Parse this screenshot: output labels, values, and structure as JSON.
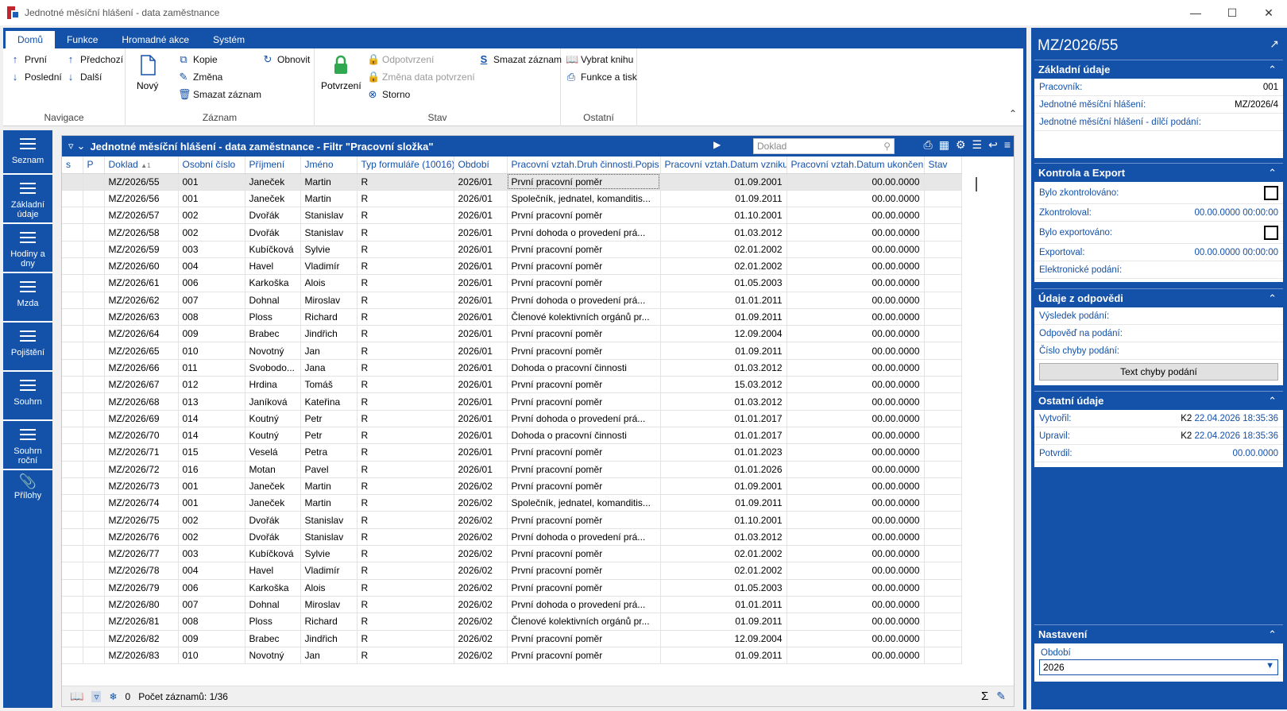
{
  "window": {
    "title": "Jednotné měsíční hlášení - data zaměstnance"
  },
  "ribbon": {
    "tabs": [
      "Domů",
      "Funkce",
      "Hromadné akce",
      "Systém"
    ],
    "groups": {
      "navigace": {
        "label": "Navigace",
        "prvni": "První",
        "predchozi": "Předchozí",
        "posledni": "Poslední",
        "dalsi": "Další"
      },
      "zaznam": {
        "label": "Záznam",
        "novy": "Nový",
        "kopie": "Kopie",
        "zmena": "Změna",
        "smazat": "Smazat záznam",
        "obnovit": "Obnovit"
      },
      "stav": {
        "label": "Stav",
        "potvrzeni": "Potvrzení",
        "odpotvrzeni": "Odpotvrzení",
        "zmena_data": "Změna data potvrzení",
        "storno": "Storno",
        "smazat": "Smazat záznam"
      },
      "ostatni": {
        "label": "Ostatní",
        "vybrat_knihu": "Vybrat knihu",
        "funkce_tisk": "Funkce a tisk"
      }
    }
  },
  "leftnav": [
    "Seznam",
    "Základní údaje",
    "Hodiny a dny",
    "Mzda",
    "Pojištění",
    "Souhrn",
    "Souhrn roční",
    "Přílohy"
  ],
  "grid": {
    "title": "Jednotné měsíční hlášení - data zaměstnance - Filtr \"Pracovní složka\"",
    "search_placeholder": "Doklad",
    "columns": [
      "s",
      "P",
      "Doklad",
      "Osobní číslo",
      "Příjmení",
      "Jméno",
      "Typ formuláře (10016)",
      "Období",
      "Pracovní vztah.Druh činnosti.Popis",
      "Pracovní vztah.Datum vzniku",
      "Pracovní vztah.Datum ukončení",
      "Stav"
    ],
    "sort_indicator": "▲1",
    "rows": [
      [
        "",
        "",
        "MZ/2026/55",
        "001",
        "Janeček",
        "Martin",
        "R",
        "2026/01",
        "První pracovní poměr",
        "01.09.2001",
        "00.00.0000",
        ""
      ],
      [
        "",
        "",
        "MZ/2026/56",
        "001",
        "Janeček",
        "Martin",
        "R",
        "2026/01",
        "Společník, jednatel, komanditis...",
        "01.09.2011",
        "00.00.0000",
        ""
      ],
      [
        "",
        "",
        "MZ/2026/57",
        "002",
        "Dvořák",
        "Stanislav",
        "R",
        "2026/01",
        "První pracovní poměr",
        "01.10.2001",
        "00.00.0000",
        ""
      ],
      [
        "",
        "",
        "MZ/2026/58",
        "002",
        "Dvořák",
        "Stanislav",
        "R",
        "2026/01",
        "První dohoda o provedení prá...",
        "01.03.2012",
        "00.00.0000",
        ""
      ],
      [
        "",
        "",
        "MZ/2026/59",
        "003",
        "Kubíčková",
        "Sylvie",
        "R",
        "2026/01",
        "První pracovní poměr",
        "02.01.2002",
        "00.00.0000",
        ""
      ],
      [
        "",
        "",
        "MZ/2026/60",
        "004",
        "Havel",
        "Vladimír",
        "R",
        "2026/01",
        "První pracovní poměr",
        "02.01.2002",
        "00.00.0000",
        ""
      ],
      [
        "",
        "",
        "MZ/2026/61",
        "006",
        "Karkoška",
        "Alois",
        "R",
        "2026/01",
        "První pracovní poměr",
        "01.05.2003",
        "00.00.0000",
        ""
      ],
      [
        "",
        "",
        "MZ/2026/62",
        "007",
        "Dohnal",
        "Miroslav",
        "R",
        "2026/01",
        "První dohoda o provedení prá...",
        "01.01.2011",
        "00.00.0000",
        ""
      ],
      [
        "",
        "",
        "MZ/2026/63",
        "008",
        "Ploss",
        "Richard",
        "R",
        "2026/01",
        "Členové kolektivních orgánů pr...",
        "01.09.2011",
        "00.00.0000",
        ""
      ],
      [
        "",
        "",
        "MZ/2026/64",
        "009",
        "Brabec",
        "Jindřich",
        "R",
        "2026/01",
        "První pracovní poměr",
        "12.09.2004",
        "00.00.0000",
        ""
      ],
      [
        "",
        "",
        "MZ/2026/65",
        "010",
        "Novotný",
        "Jan",
        "R",
        "2026/01",
        "První pracovní poměr",
        "01.09.2011",
        "00.00.0000",
        ""
      ],
      [
        "",
        "",
        "MZ/2026/66",
        "011",
        "Svobodo...",
        "Jana",
        "R",
        "2026/01",
        "Dohoda o pracovní činnosti",
        "01.03.2012",
        "00.00.0000",
        ""
      ],
      [
        "",
        "",
        "MZ/2026/67",
        "012",
        "Hrdina",
        "Tomáš",
        "R",
        "2026/01",
        "První pracovní poměr",
        "15.03.2012",
        "00.00.0000",
        ""
      ],
      [
        "",
        "",
        "MZ/2026/68",
        "013",
        "Janíková",
        "Kateřina",
        "R",
        "2026/01",
        "První pracovní poměr",
        "01.03.2012",
        "00.00.0000",
        ""
      ],
      [
        "",
        "",
        "MZ/2026/69",
        "014",
        "Koutný",
        "Petr",
        "R",
        "2026/01",
        "První dohoda o provedení prá...",
        "01.01.2017",
        "00.00.0000",
        ""
      ],
      [
        "",
        "",
        "MZ/2026/70",
        "014",
        "Koutný",
        "Petr",
        "R",
        "2026/01",
        "Dohoda o pracovní činnosti",
        "01.01.2017",
        "00.00.0000",
        ""
      ],
      [
        "",
        "",
        "MZ/2026/71",
        "015",
        "Veselá",
        "Petra",
        "R",
        "2026/01",
        "První pracovní poměr",
        "01.01.2023",
        "00.00.0000",
        ""
      ],
      [
        "",
        "",
        "MZ/2026/72",
        "016",
        "Motan",
        "Pavel",
        "R",
        "2026/01",
        "První pracovní poměr",
        "01.01.2026",
        "00.00.0000",
        ""
      ],
      [
        "",
        "",
        "MZ/2026/73",
        "001",
        "Janeček",
        "Martin",
        "R",
        "2026/02",
        "První pracovní poměr",
        "01.09.2001",
        "00.00.0000",
        ""
      ],
      [
        "",
        "",
        "MZ/2026/74",
        "001",
        "Janeček",
        "Martin",
        "R",
        "2026/02",
        "Společník, jednatel, komanditis...",
        "01.09.2011",
        "00.00.0000",
        ""
      ],
      [
        "",
        "",
        "MZ/2026/75",
        "002",
        "Dvořák",
        "Stanislav",
        "R",
        "2026/02",
        "První pracovní poměr",
        "01.10.2001",
        "00.00.0000",
        ""
      ],
      [
        "",
        "",
        "MZ/2026/76",
        "002",
        "Dvořák",
        "Stanislav",
        "R",
        "2026/02",
        "První dohoda o provedení prá...",
        "01.03.2012",
        "00.00.0000",
        ""
      ],
      [
        "",
        "",
        "MZ/2026/77",
        "003",
        "Kubíčková",
        "Sylvie",
        "R",
        "2026/02",
        "První pracovní poměr",
        "02.01.2002",
        "00.00.0000",
        ""
      ],
      [
        "",
        "",
        "MZ/2026/78",
        "004",
        "Havel",
        "Vladimír",
        "R",
        "2026/02",
        "První pracovní poměr",
        "02.01.2002",
        "00.00.0000",
        ""
      ],
      [
        "",
        "",
        "MZ/2026/79",
        "006",
        "Karkoška",
        "Alois",
        "R",
        "2026/02",
        "První pracovní poměr",
        "01.05.2003",
        "00.00.0000",
        ""
      ],
      [
        "",
        "",
        "MZ/2026/80",
        "007",
        "Dohnal",
        "Miroslav",
        "R",
        "2026/02",
        "První dohoda o provedení prá...",
        "01.01.2011",
        "00.00.0000",
        ""
      ],
      [
        "",
        "",
        "MZ/2026/81",
        "008",
        "Ploss",
        "Richard",
        "R",
        "2026/02",
        "Členové kolektivních orgánů pr...",
        "01.09.2011",
        "00.00.0000",
        ""
      ],
      [
        "",
        "",
        "MZ/2026/82",
        "009",
        "Brabec",
        "Jindřich",
        "R",
        "2026/02",
        "První pracovní poměr",
        "12.09.2004",
        "00.00.0000",
        ""
      ],
      [
        "",
        "",
        "MZ/2026/83",
        "010",
        "Novotný",
        "Jan",
        "R",
        "2026/02",
        "První pracovní poměr",
        "01.09.2011",
        "00.00.0000",
        ""
      ]
    ],
    "footer": {
      "filter_count": "0",
      "record_count": "Počet záznamů: 1/36"
    }
  },
  "detail": {
    "title": "MZ/2026/55",
    "zakladni": {
      "header": "Základní údaje",
      "pracovnik_label": "Pracovník:",
      "pracovnik": "001",
      "jmh_label": "Jednotné měsíční hlášení:",
      "jmh": "MZ/2026/4",
      "dilci_label": "Jednotné měsíční hlášení - dílčí podání:"
    },
    "kontrola": {
      "header": "Kontrola a Export",
      "zkontrolovano_label": "Bylo zkontrolováno:",
      "zkontroloval_label": "Zkontroloval:",
      "zkontroloval": "00.00.0000 00:00:00",
      "exportovano_label": "Bylo exportováno:",
      "exportoval_label": "Exportoval:",
      "exportoval": "00.00.0000 00:00:00",
      "elektronicke_label": "Elektronické podání:"
    },
    "odpoved": {
      "header": "Údaje z odpovědi",
      "vysledek_label": "Výsledek podání:",
      "odpoved_label": "Odpověď na podání:",
      "cislo_chyby_label": "Číslo chyby podání:",
      "text_chyby_button": "Text chyby podání"
    },
    "ostatni": {
      "header": "Ostatní údaje",
      "vytvoril_label": "Vytvořil:",
      "vytvoril_user": "K2",
      "vytvoril_date": "22.04.2026 18:35:36",
      "upravil_label": "Upravil:",
      "upravil_user": "K2",
      "upravil_date": "22.04.2026 18:35:36",
      "potvrdil_label": "Potvrdil:",
      "potvrdil": "00.00.0000"
    },
    "nastaveni": {
      "header": "Nastavení",
      "obdobi_label": "Období",
      "obdobi": "2026"
    }
  },
  "colors": {
    "accent": "#1451a8",
    "selected_row": "#e7e7e7"
  }
}
